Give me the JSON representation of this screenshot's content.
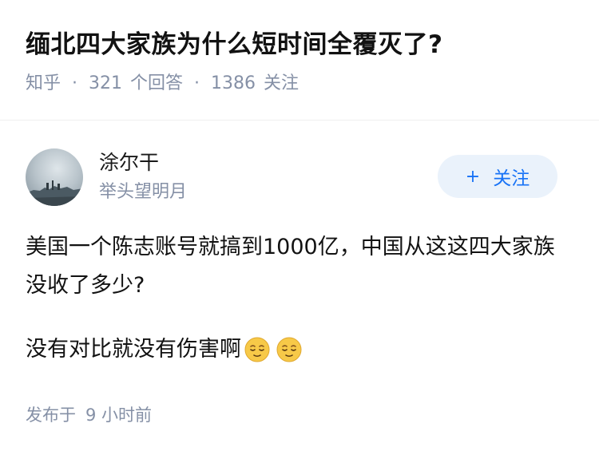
{
  "question": {
    "title": "缅北四大家族为什么短时间全覆灭了?",
    "source": "知乎",
    "answer_count": "321",
    "answer_label": "个回答",
    "follow_count": "1386",
    "follow_label": "关注"
  },
  "author": {
    "name": "涂尔干",
    "bio": "举头望明月",
    "follow_button": "关注",
    "follow_icon": "plus-icon"
  },
  "answer": {
    "paragraph1": "美国一个陈志账号就搞到1000亿，中国从这这四大家族没收了多少?",
    "paragraph2": "没有对比就没有伤害啊",
    "emojis": [
      "relieved-face-emoji",
      "relieved-face-emoji"
    ]
  },
  "footer": {
    "published_label": "发布于",
    "time": "9 小时前"
  },
  "colors": {
    "accent": "#1772f6",
    "follow_bg": "#eaf2fb",
    "meta_gray": "#8590a6",
    "emoji_yellow": "#f7c948"
  }
}
